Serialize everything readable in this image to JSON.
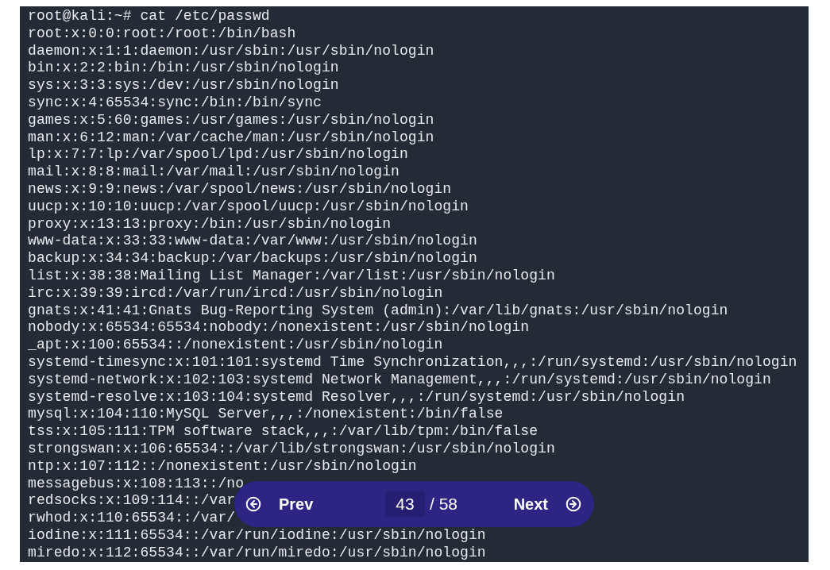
{
  "terminal": {
    "lines": [
      "root@kali:~# cat /etc/passwd",
      "root:x:0:0:root:/root:/bin/bash",
      "daemon:x:1:1:daemon:/usr/sbin:/usr/sbin/nologin",
      "bin:x:2:2:bin:/bin:/usr/sbin/nologin",
      "sys:x:3:3:sys:/dev:/usr/sbin/nologin",
      "sync:x:4:65534:sync:/bin:/bin/sync",
      "games:x:5:60:games:/usr/games:/usr/sbin/nologin",
      "man:x:6:12:man:/var/cache/man:/usr/sbin/nologin",
      "lp:x:7:7:lp:/var/spool/lpd:/usr/sbin/nologin",
      "mail:x:8:8:mail:/var/mail:/usr/sbin/nologin",
      "news:x:9:9:news:/var/spool/news:/usr/sbin/nologin",
      "uucp:x:10:10:uucp:/var/spool/uucp:/usr/sbin/nologin",
      "proxy:x:13:13:proxy:/bin:/usr/sbin/nologin",
      "www-data:x:33:33:www-data:/var/www:/usr/sbin/nologin",
      "backup:x:34:34:backup:/var/backups:/usr/sbin/nologin",
      "list:x:38:38:Mailing List Manager:/var/list:/usr/sbin/nologin",
      "irc:x:39:39:ircd:/var/run/ircd:/usr/sbin/nologin",
      "gnats:x:41:41:Gnats Bug-Reporting System (admin):/var/lib/gnats:/usr/sbin/nologin",
      "nobody:x:65534:65534:nobody:/nonexistent:/usr/sbin/nologin",
      "_apt:x:100:65534::/nonexistent:/usr/sbin/nologin",
      "systemd-timesync:x:101:101:systemd Time Synchronization,,,:/run/systemd:/usr/sbin/nologin",
      "systemd-network:x:102:103:systemd Network Management,,,:/run/systemd:/usr/sbin/nologin",
      "systemd-resolve:x:103:104:systemd Resolver,,,:/run/systemd:/usr/sbin/nologin",
      "mysql:x:104:110:MySQL Server,,,:/nonexistent:/bin/false",
      "tss:x:105:111:TPM software stack,,,:/var/lib/tpm:/bin/false",
      "strongswan:x:106:65534::/var/lib/strongswan:/usr/sbin/nologin",
      "ntp:x:107:112::/nonexistent:/usr/sbin/nologin",
      "messagebus:x:108:113::/no",
      "redsocks:x:109:114::/var",
      "rwhod:x:110:65534::/var/",
      "iodine:x:111:65534::/var/run/iodine:/usr/sbin/nologin",
      "miredo:x:112:65534::/var/run/miredo:/usr/sbin/nologin"
    ]
  },
  "pager": {
    "prev_label": "Prev",
    "current_page": "43",
    "total": "/ 58",
    "next_label": "Next"
  }
}
